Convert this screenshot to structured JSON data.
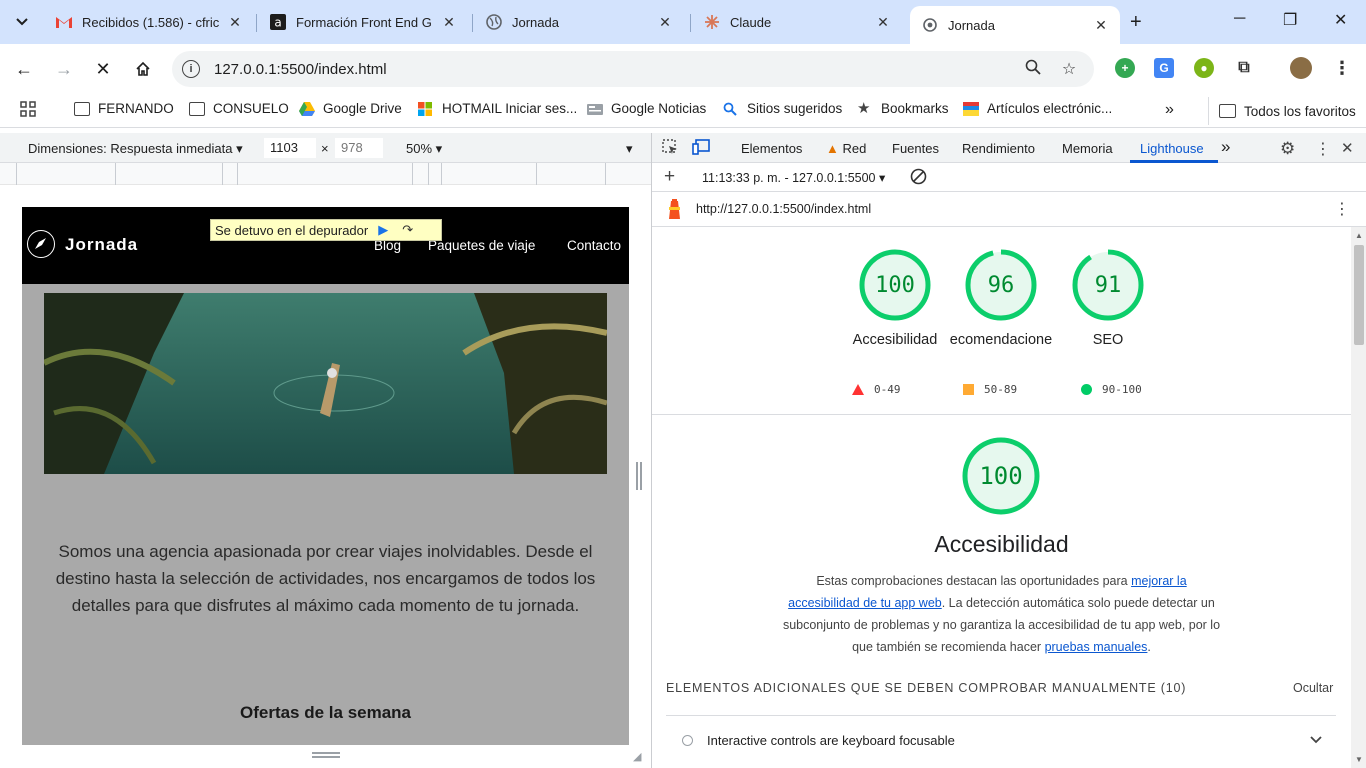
{
  "tabs": [
    {
      "title": "Recibidos (1.586) - cfric",
      "icon": "gmail-icon"
    },
    {
      "title": "Formación Front End G",
      "icon": "alura-icon"
    },
    {
      "title": "Jornada",
      "icon": "globe-icon"
    },
    {
      "title": "Claude",
      "icon": "claude-icon"
    },
    {
      "title": "Jornada",
      "icon": "globe-icon",
      "active": true
    }
  ],
  "toolbar": {
    "url": "127.0.0.1:5500/index.html"
  },
  "bookmarks": [
    {
      "label": "FERNANDO",
      "icon": "folder-icon"
    },
    {
      "label": "CONSUELO",
      "icon": "folder-icon"
    },
    {
      "label": "Google Drive",
      "icon": "drive-icon"
    },
    {
      "label": "HOTMAIL Iniciar ses...",
      "icon": "microsoft-icon"
    },
    {
      "label": "Google Noticias",
      "icon": "news-icon"
    },
    {
      "label": "Sitios sugeridos",
      "icon": "search-icon"
    },
    {
      "label": "Bookmarks",
      "icon": "star-icon"
    },
    {
      "label": "Artículos electrónic...",
      "icon": "store-icon"
    }
  ],
  "bookmarks_more": "»",
  "all_favorites": "Todos los favoritos",
  "device_toolbar": {
    "dimensions_label": "Dimensiones: Respuesta inmediata",
    "width": "1103",
    "times": "×",
    "height": "978",
    "zoom": "50%"
  },
  "page": {
    "logo": "Jornada",
    "nav": [
      "Blog",
      "Paquetes de viaje",
      "Contacto"
    ],
    "debugger_label": "Se detuvo en el depurador",
    "paragraph": "Somos una agencia apasionada por crear viajes inolvidables. Desde el destino hasta la selección de actividades, nos encargamos de todos los detalles para que disfrutes al máximo cada momento de tu jornada.",
    "section_title": "Ofertas de la semana"
  },
  "devtools": {
    "tabs": [
      "Elementos",
      "Red",
      "Fuentes",
      "Rendimiento",
      "Memoria",
      "Lighthouse"
    ],
    "active_tab": "Lighthouse",
    "more": "»",
    "report_select": "11:13:33 p. m. - 127.0.0.1:5500",
    "report_url": "http://127.0.0.1:5500/index.html",
    "scores": [
      {
        "value": "100",
        "label": "Accesibilidad",
        "score": 1.0
      },
      {
        "value": "96",
        "label": "ecomendacione",
        "score": 0.96
      },
      {
        "value": "91",
        "label": "SEO",
        "score": 0.91
      }
    ],
    "legend": [
      {
        "range": "0-49",
        "color": "#f33"
      },
      {
        "range": "50-89",
        "color": "#fa3"
      },
      {
        "range": "90-100",
        "color": "#0c6"
      }
    ],
    "main_score": {
      "value": "100",
      "score": 1.0
    },
    "main_title": "Accesibilidad",
    "desc_part1": "Estas comprobaciones destacan las oportunidades para ",
    "desc_link1": "mejorar la accesibilidad de tu app web",
    "desc_part2": ". La detección automática solo puede detectar un subconjunto de problemas y no garantiza la accesibilidad de tu app web, por lo que también se recomienda hacer ",
    "desc_link2": "pruebas manuales",
    "desc_part3": ".",
    "manual_header": "ELEMENTOS ADICIONALES QUE SE DEBEN COMPROBAR MANUALMENTE",
    "manual_count": "(10)",
    "hide_label": "Ocultar",
    "audit_item": "Interactive controls are keyboard focusable"
  },
  "colors": {
    "tabstrip": "#d3e3fd",
    "accent": "#0b57d0",
    "pass_green": "#0cce6b"
  }
}
